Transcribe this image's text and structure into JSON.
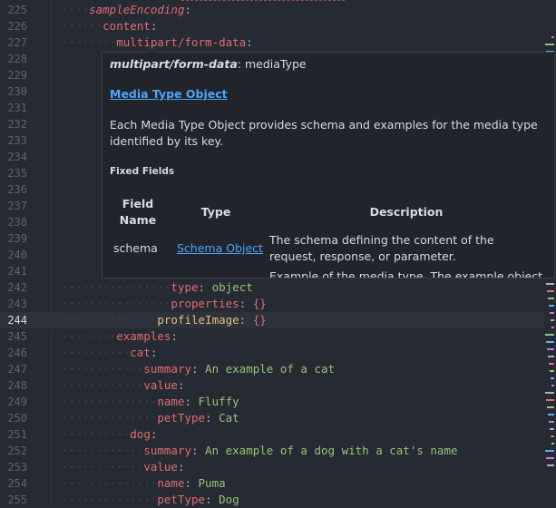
{
  "lines": [
    {
      "n": "225",
      "indent": 2,
      "key": "sampleEncoding",
      "em": true
    },
    {
      "n": "226",
      "indent": 3,
      "key": "content"
    },
    {
      "n": "227",
      "indent": 4,
      "key": "multipart/form-data"
    },
    {
      "n": "228",
      "indent": 0
    },
    {
      "n": "229",
      "indent": 0
    },
    {
      "n": "230",
      "indent": 0
    },
    {
      "n": "231",
      "indent": 0
    },
    {
      "n": "232",
      "indent": 0
    },
    {
      "n": "233",
      "indent": 0
    },
    {
      "n": "234",
      "indent": 0
    },
    {
      "n": "235",
      "indent": 0
    },
    {
      "n": "236",
      "indent": 0
    },
    {
      "n": "237",
      "indent": 0
    },
    {
      "n": "238",
      "indent": 0
    },
    {
      "n": "239",
      "indent": 0
    },
    {
      "n": "240",
      "indent": 0
    },
    {
      "n": "241",
      "indent": 0
    },
    {
      "n": "242",
      "indent": 8,
      "key": "type",
      "value": "object"
    },
    {
      "n": "243",
      "indent": 8,
      "key": "properties",
      "brace": "{}"
    },
    {
      "n": "244",
      "indent": 7,
      "key": "profileImage",
      "brace": "{}",
      "active": true
    },
    {
      "n": "245",
      "indent": 4,
      "key": "examples"
    },
    {
      "n": "246",
      "indent": 5,
      "key": "cat"
    },
    {
      "n": "247",
      "indent": 6,
      "key": "summary",
      "value": "An example of a cat"
    },
    {
      "n": "248",
      "indent": 6,
      "key": "value"
    },
    {
      "n": "249",
      "indent": 7,
      "key": "name",
      "value": "Fluffy"
    },
    {
      "n": "250",
      "indent": 7,
      "key": "petType",
      "value": "Cat"
    },
    {
      "n": "251",
      "indent": 5,
      "key": "dog"
    },
    {
      "n": "252",
      "indent": 6,
      "key": "summary",
      "value": "An example of a dog with a cat's name"
    },
    {
      "n": "253",
      "indent": 6,
      "key": "value"
    },
    {
      "n": "254",
      "indent": 7,
      "key": "name",
      "value": "Puma"
    },
    {
      "n": "255",
      "indent": 7,
      "key": "petType",
      "value": "Dog"
    }
  ],
  "hover": {
    "title_key": "multipart/form-data",
    "title_rest": ": mediaType",
    "link": "Media Type Object",
    "description": "Each Media Type Object provides schema and examples for the media type identified by its key.",
    "fixed_fields": "Fixed Fields",
    "headers": {
      "field": "Field Name",
      "type": "Type",
      "description": "Description"
    },
    "rows": [
      {
        "field": "schema",
        "type": "Schema Object",
        "description": "The schema defining the content of the request, response, or parameter."
      },
      {
        "field": "",
        "type": "",
        "description": "Example of the media type. The example object"
      }
    ]
  },
  "colors": {
    "background": "#262a33",
    "key": "#e06c75",
    "string": "#98c379",
    "link": "#4fa3f7",
    "tooltip": "#21252b"
  }
}
